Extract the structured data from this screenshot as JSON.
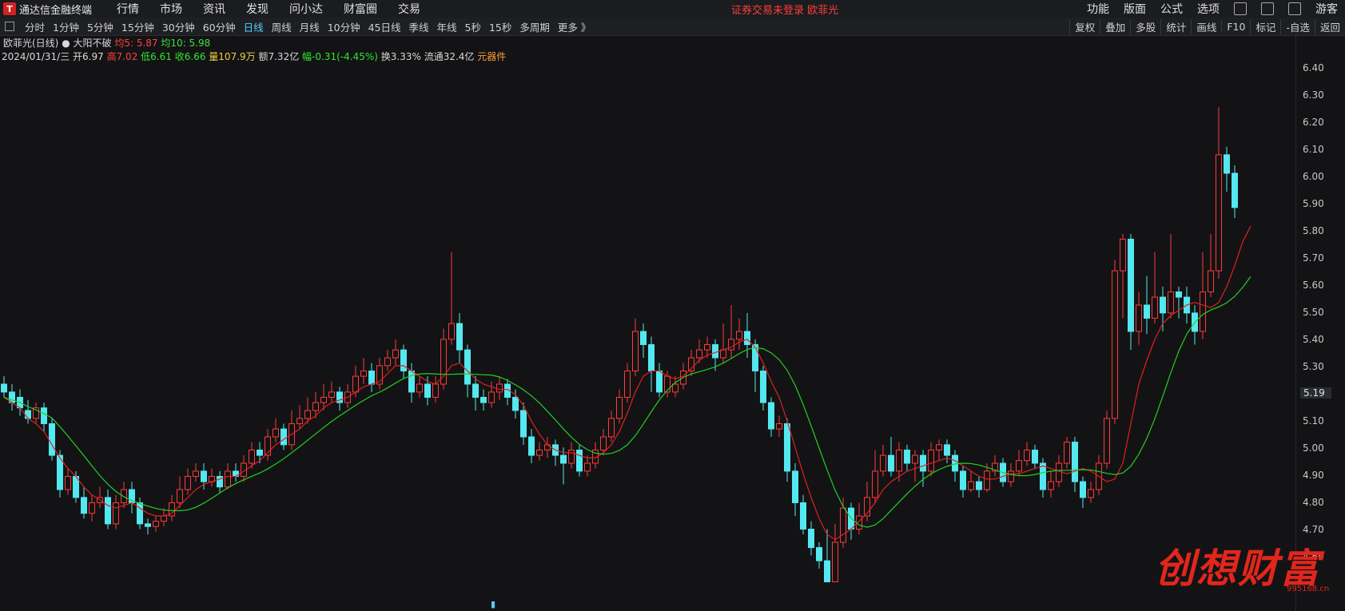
{
  "menubar": {
    "app_title": "通达信金融终端",
    "items": [
      "行情",
      "市场",
      "资讯",
      "发现",
      "问小达",
      "财富圈",
      "交易"
    ],
    "notice": "证券交易未登录  欧菲光",
    "right_items": [
      "功能",
      "版面",
      "公式",
      "选项"
    ],
    "guest": "游客"
  },
  "periodbar": {
    "periods": [
      "分时",
      "1分钟",
      "5分钟",
      "15分钟",
      "30分钟",
      "60分钟",
      "日线",
      "周线",
      "月线",
      "10分钟",
      "45日线",
      "季线",
      "年线",
      "5秒",
      "15秒",
      "多周期",
      "更多 》"
    ],
    "active": "日线",
    "tools": [
      "复权",
      "叠加",
      "多股",
      "统计",
      "画线",
      "F10",
      "标记",
      "-自选",
      "返回"
    ]
  },
  "info": {
    "stock": "欧菲光(日线)",
    "indicator": "大阳不破",
    "ma5_label": "均5: 5.87",
    "ma10_label": "均10: 5.98",
    "date": "2024/01/31/三",
    "open": "开6.97",
    "high": "高7.02",
    "low": "低6.61",
    "close": "收6.66",
    "volume": "量107.9万",
    "amount": "额7.32亿",
    "change": "幅-0.31(-4.45%)",
    "turnover": "换3.33%",
    "float": "流通32.4亿",
    "sector": "元器件"
  },
  "axis": {
    "ticks": [
      "6.40",
      "6.30",
      "6.20",
      "6.10",
      "6.00",
      "5.90",
      "5.80",
      "5.70",
      "5.60",
      "5.50",
      "5.40",
      "5.30",
      "5.10",
      "5.00",
      "4.90",
      "4.80",
      "4.70",
      "4.60"
    ],
    "current_price": "5.19"
  },
  "chart_data": {
    "type": "candlestick",
    "y_range": [
      4.45,
      6.48
    ],
    "x_count": 163,
    "candles": [
      [
        5.25,
        5.22,
        5.28,
        5.2
      ],
      [
        5.22,
        5.18,
        5.25,
        5.15
      ],
      [
        5.2,
        5.16,
        5.23,
        5.13
      ],
      [
        5.15,
        5.12,
        5.19,
        5.1
      ],
      [
        5.12,
        5.16,
        5.18,
        5.1
      ],
      [
        5.16,
        5.1,
        5.18,
        5.07
      ],
      [
        5.1,
        4.98,
        5.12,
        4.96
      ],
      [
        4.98,
        4.85,
        5.0,
        4.82
      ],
      [
        4.85,
        4.9,
        4.93,
        4.83
      ],
      [
        4.9,
        4.82,
        4.92,
        4.8
      ],
      [
        4.82,
        4.76,
        4.86,
        4.74
      ],
      [
        4.76,
        4.8,
        4.83,
        4.73
      ],
      [
        4.8,
        4.82,
        4.86,
        4.78
      ],
      [
        4.82,
        4.72,
        4.85,
        4.7
      ],
      [
        4.72,
        4.8,
        4.83,
        4.7
      ],
      [
        4.8,
        4.85,
        4.88,
        4.78
      ],
      [
        4.85,
        4.8,
        4.88,
        4.76
      ],
      [
        4.8,
        4.72,
        4.82,
        4.7
      ],
      [
        4.72,
        4.71,
        4.74,
        4.68
      ],
      [
        4.71,
        4.73,
        4.75,
        4.69
      ],
      [
        4.73,
        4.75,
        4.78,
        4.71
      ],
      [
        4.75,
        4.8,
        4.83,
        4.73
      ],
      [
        4.8,
        4.85,
        4.9,
        4.78
      ],
      [
        4.85,
        4.9,
        4.93,
        4.83
      ],
      [
        4.9,
        4.92,
        4.95,
        4.88
      ],
      [
        4.92,
        4.88,
        4.95,
        4.85
      ],
      [
        4.88,
        4.9,
        4.93,
        4.86
      ],
      [
        4.9,
        4.86,
        4.92,
        4.84
      ],
      [
        4.86,
        4.92,
        4.95,
        4.85
      ],
      [
        4.92,
        4.9,
        4.95,
        4.88
      ],
      [
        4.9,
        4.95,
        4.98,
        4.88
      ],
      [
        4.95,
        5.0,
        5.03,
        4.93
      ],
      [
        5.0,
        4.98,
        5.03,
        4.95
      ],
      [
        4.98,
        5.05,
        5.08,
        4.96
      ],
      [
        5.05,
        5.08,
        5.12,
        5.03
      ],
      [
        5.08,
        5.02,
        5.1,
        5.0
      ],
      [
        5.02,
        5.1,
        5.15,
        5.0
      ],
      [
        5.1,
        5.12,
        5.17,
        5.08
      ],
      [
        5.12,
        5.15,
        5.2,
        5.1
      ],
      [
        5.15,
        5.18,
        5.22,
        5.12
      ],
      [
        5.18,
        5.2,
        5.25,
        5.15
      ],
      [
        5.2,
        5.22,
        5.26,
        5.18
      ],
      [
        5.22,
        5.18,
        5.24,
        5.15
      ],
      [
        5.18,
        5.22,
        5.25,
        5.16
      ],
      [
        5.22,
        5.28,
        5.32,
        5.2
      ],
      [
        5.28,
        5.3,
        5.35,
        5.25
      ],
      [
        5.3,
        5.25,
        5.33,
        5.22
      ],
      [
        5.25,
        5.32,
        5.35,
        5.23
      ],
      [
        5.32,
        5.35,
        5.38,
        5.3
      ],
      [
        5.35,
        5.38,
        5.42,
        5.32
      ],
      [
        5.38,
        5.3,
        5.4,
        5.27
      ],
      [
        5.3,
        5.22,
        5.33,
        5.18
      ],
      [
        5.22,
        5.25,
        5.28,
        5.2
      ],
      [
        5.25,
        5.2,
        5.28,
        5.17
      ],
      [
        5.2,
        5.25,
        5.28,
        5.18
      ],
      [
        5.25,
        5.42,
        5.46,
        5.23
      ],
      [
        5.42,
        5.48,
        5.75,
        5.4
      ],
      [
        5.48,
        5.38,
        5.52,
        5.33
      ],
      [
        5.38,
        5.25,
        5.4,
        5.2
      ],
      [
        5.25,
        5.2,
        5.28,
        5.15
      ],
      [
        5.2,
        5.18,
        5.23,
        5.15
      ],
      [
        5.18,
        5.22,
        5.26,
        5.16
      ],
      [
        5.22,
        5.25,
        5.28,
        5.19
      ],
      [
        5.25,
        5.2,
        5.27,
        5.17
      ],
      [
        5.2,
        5.15,
        5.23,
        5.12
      ],
      [
        5.15,
        5.05,
        5.18,
        5.02
      ],
      [
        5.05,
        4.98,
        5.08,
        4.95
      ],
      [
        4.98,
        5.0,
        5.03,
        4.96
      ],
      [
        5.0,
        5.02,
        5.05,
        4.97
      ],
      [
        5.02,
        4.98,
        5.04,
        4.94
      ],
      [
        4.98,
        4.95,
        5.01,
        4.87
      ],
      [
        4.95,
        5.0,
        5.03,
        4.93
      ],
      [
        5.0,
        4.92,
        5.02,
        4.9
      ],
      [
        4.92,
        4.95,
        4.98,
        4.9
      ],
      [
        4.95,
        5.0,
        5.03,
        4.93
      ],
      [
        5.0,
        5.05,
        5.08,
        4.98
      ],
      [
        5.05,
        5.12,
        5.15,
        5.03
      ],
      [
        5.12,
        5.2,
        5.23,
        5.1
      ],
      [
        5.2,
        5.3,
        5.33,
        5.18
      ],
      [
        5.3,
        5.45,
        5.5,
        5.28
      ],
      [
        5.45,
        5.4,
        5.48,
        5.35
      ],
      [
        5.4,
        5.3,
        5.43,
        5.22
      ],
      [
        5.3,
        5.22,
        5.33,
        5.2
      ],
      [
        5.22,
        5.28,
        5.3,
        5.2
      ],
      [
        5.22,
        5.25,
        5.28,
        5.2
      ],
      [
        5.25,
        5.3,
        5.33,
        5.23
      ],
      [
        5.3,
        5.35,
        5.38,
        5.28
      ],
      [
        5.35,
        5.38,
        5.42,
        5.33
      ],
      [
        5.38,
        5.4,
        5.43,
        5.35
      ],
      [
        5.4,
        5.35,
        5.42,
        5.3
      ],
      [
        5.35,
        5.38,
        5.48,
        5.33
      ],
      [
        5.38,
        5.42,
        5.55,
        5.35
      ],
      [
        5.42,
        5.45,
        5.5,
        5.38
      ],
      [
        5.45,
        5.4,
        5.52,
        5.35
      ],
      [
        5.4,
        5.3,
        5.42,
        5.22
      ],
      [
        5.3,
        5.18,
        5.32,
        5.15
      ],
      [
        5.18,
        5.08,
        5.2,
        5.05
      ],
      [
        5.08,
        5.1,
        5.13,
        5.05
      ],
      [
        5.1,
        4.92,
        5.12,
        4.88
      ],
      [
        4.92,
        4.8,
        4.95,
        4.75
      ],
      [
        4.8,
        4.7,
        4.83,
        4.68
      ],
      [
        4.7,
        4.63,
        4.73,
        4.6
      ],
      [
        4.63,
        4.58,
        4.65,
        4.55
      ],
      [
        4.58,
        4.5,
        4.7,
        4.5
      ],
      [
        4.5,
        4.65,
        4.72,
        4.5
      ],
      [
        4.65,
        4.78,
        4.82,
        4.63
      ],
      [
        4.78,
        4.7,
        4.8,
        4.66
      ],
      [
        4.7,
        4.75,
        4.8,
        4.68
      ],
      [
        4.75,
        4.82,
        4.88,
        4.73
      ],
      [
        4.82,
        4.92,
        5.0,
        4.8
      ],
      [
        4.92,
        4.98,
        5.02,
        4.9
      ],
      [
        4.98,
        4.92,
        5.05,
        4.9
      ],
      [
        4.92,
        5.0,
        5.03,
        4.88
      ],
      [
        5.0,
        4.95,
        5.02,
        4.92
      ],
      [
        4.95,
        4.98,
        5.0,
        4.88
      ],
      [
        4.98,
        4.92,
        5.0,
        4.86
      ],
      [
        4.92,
        5.0,
        5.03,
        4.9
      ],
      [
        5.0,
        5.02,
        5.04,
        4.96
      ],
      [
        5.02,
        4.98,
        5.04,
        4.95
      ],
      [
        4.98,
        4.92,
        5.0,
        4.88
      ],
      [
        4.92,
        4.85,
        4.94,
        4.82
      ],
      [
        4.85,
        4.88,
        4.92,
        4.84
      ],
      [
        4.88,
        4.85,
        4.9,
        4.82
      ],
      [
        4.85,
        4.92,
        4.95,
        4.84
      ],
      [
        4.92,
        4.95,
        4.98,
        4.9
      ],
      [
        4.95,
        4.88,
        4.97,
        4.86
      ],
      [
        4.88,
        4.92,
        4.95,
        4.86
      ],
      [
        4.92,
        4.96,
        5.0,
        4.9
      ],
      [
        4.96,
        5.0,
        5.03,
        4.94
      ],
      [
        5.0,
        4.95,
        5.02,
        4.93
      ],
      [
        4.95,
        4.85,
        4.97,
        4.82
      ],
      [
        4.85,
        4.88,
        4.92,
        4.82
      ],
      [
        4.88,
        4.95,
        4.98,
        4.86
      ],
      [
        4.95,
        5.03,
        5.05,
        4.93
      ],
      [
        5.03,
        4.88,
        5.05,
        4.84
      ],
      [
        4.88,
        4.82,
        4.9,
        4.78
      ],
      [
        4.82,
        4.85,
        4.88,
        4.8
      ],
      [
        4.85,
        4.95,
        4.98,
        4.83
      ],
      [
        4.95,
        5.12,
        5.15,
        4.93
      ],
      [
        5.12,
        5.68,
        5.72,
        5.1
      ],
      [
        5.68,
        5.8,
        5.82,
        5.5
      ],
      [
        5.8,
        5.45,
        5.82,
        5.38
      ],
      [
        5.45,
        5.55,
        5.6,
        5.4
      ],
      [
        5.55,
        5.5,
        5.66,
        5.44
      ],
      [
        5.5,
        5.58,
        5.75,
        5.48
      ],
      [
        5.58,
        5.52,
        5.62,
        5.45
      ],
      [
        5.52,
        5.6,
        5.82,
        5.5
      ],
      [
        5.6,
        5.58,
        5.62,
        5.5
      ],
      [
        5.58,
        5.52,
        5.62,
        5.48
      ],
      [
        5.52,
        5.45,
        5.55,
        5.4
      ],
      [
        5.45,
        5.6,
        5.75,
        5.42
      ],
      [
        5.6,
        5.68,
        5.82,
        5.58
      ],
      [
        5.68,
        6.12,
        6.3,
        5.65
      ],
      [
        6.12,
        6.05,
        6.15,
        5.98
      ],
      [
        6.05,
        5.92,
        6.08,
        5.88
      ]
    ],
    "ma_red": [
      5.2,
      5.18,
      5.16,
      5.12,
      5.1,
      5.07,
      5.02,
      4.97,
      4.93,
      4.9,
      4.86,
      4.83,
      4.81,
      4.79,
      4.78,
      4.79,
      4.8,
      4.78,
      4.76,
      4.75,
      4.75,
      4.76,
      4.79,
      4.82,
      4.85,
      4.87,
      4.88,
      4.89,
      4.9,
      4.9,
      4.92,
      4.94,
      4.96,
      4.99,
      5.02,
      5.04,
      5.06,
      5.08,
      5.11,
      5.13,
      5.16,
      5.18,
      5.19,
      5.2,
      5.22,
      5.24,
      5.25,
      5.26,
      5.29,
      5.32,
      5.32,
      5.3,
      5.28,
      5.26,
      5.25,
      5.28,
      5.32,
      5.33,
      5.3,
      5.27,
      5.25,
      5.24,
      5.23,
      5.23,
      5.21,
      5.17,
      5.11,
      5.06,
      5.02,
      5.0,
      4.99,
      4.99,
      4.98,
      4.97,
      4.97,
      4.99,
      5.02,
      5.07,
      5.14,
      5.22,
      5.28,
      5.3,
      5.3,
      5.28,
      5.27,
      5.28,
      5.31,
      5.34,
      5.36,
      5.37,
      5.38,
      5.39,
      5.41,
      5.42,
      5.39,
      5.33,
      5.26,
      5.2,
      5.11,
      5.01,
      4.91,
      4.82,
      4.74,
      4.68,
      4.66,
      4.68,
      4.7,
      4.73,
      4.76,
      4.8,
      4.85,
      4.88,
      4.9,
      4.92,
      4.93,
      4.94,
      4.95,
      4.96,
      4.97,
      4.96,
      4.94,
      4.92,
      4.9,
      4.89,
      4.89,
      4.9,
      4.91,
      4.91,
      4.92,
      4.93,
      4.94,
      4.93,
      4.92,
      4.91,
      4.92,
      4.93,
      4.92,
      4.9,
      4.88,
      4.89,
      4.95,
      5.1,
      5.25,
      5.34,
      5.42,
      5.48,
      5.51,
      5.53,
      5.55,
      5.56,
      5.55,
      5.54,
      5.56,
      5.62,
      5.7,
      5.79,
      5.85
    ]
  }
}
